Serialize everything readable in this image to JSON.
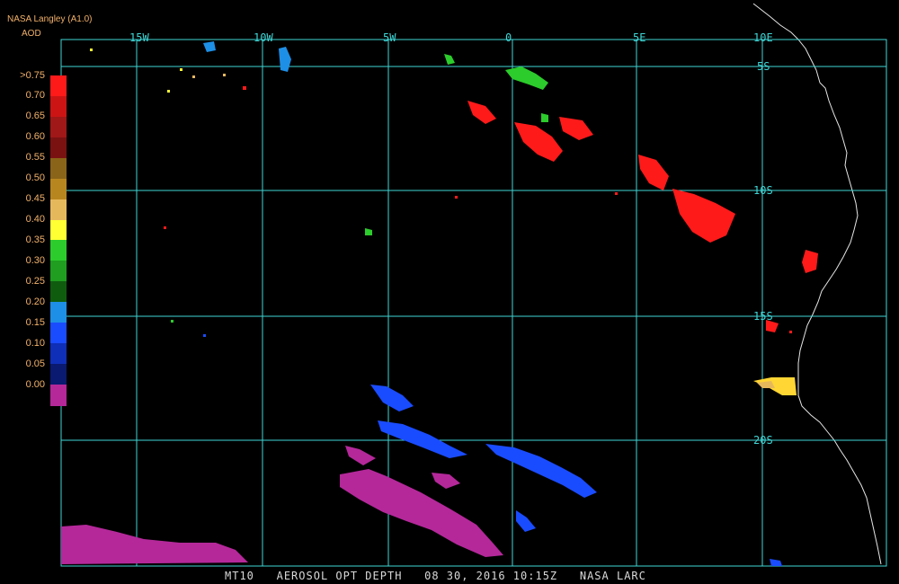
{
  "header": {
    "credit": "NASA Langley (A1.0)",
    "unit": "AOD"
  },
  "legend": {
    "labels": [
      ">0.75",
      "0.70",
      "0.65",
      "0.60",
      "0.55",
      "0.50",
      "0.45",
      "0.40",
      "0.35",
      "0.30",
      "0.25",
      "0.20",
      "0.15",
      "0.10",
      "0.05",
      "0.00"
    ],
    "colors": [
      "#ff1a1a",
      "#cc1414",
      "#a01818",
      "#7a1212",
      "#8a6418",
      "#b8861e",
      "#e6b85c",
      "#ffff33",
      "#2ccc2c",
      "#1f9e1f",
      "#0f5c0f",
      "#1e8fe6",
      "#1a4cff",
      "#0f2fb8",
      "#0a1a70",
      "#b4289a"
    ]
  },
  "grid": {
    "longitudes": [
      "15W",
      "10W",
      "5W",
      "0",
      "5E",
      "10E"
    ],
    "latitudes": [
      "5S",
      "10S",
      "15S",
      "20S"
    ]
  },
  "footer": {
    "sensor": "MT10",
    "product": "AEROSOL OPT DEPTH",
    "datetime": "08 30, 2016 10:15Z",
    "source": "NASA LARC"
  }
}
